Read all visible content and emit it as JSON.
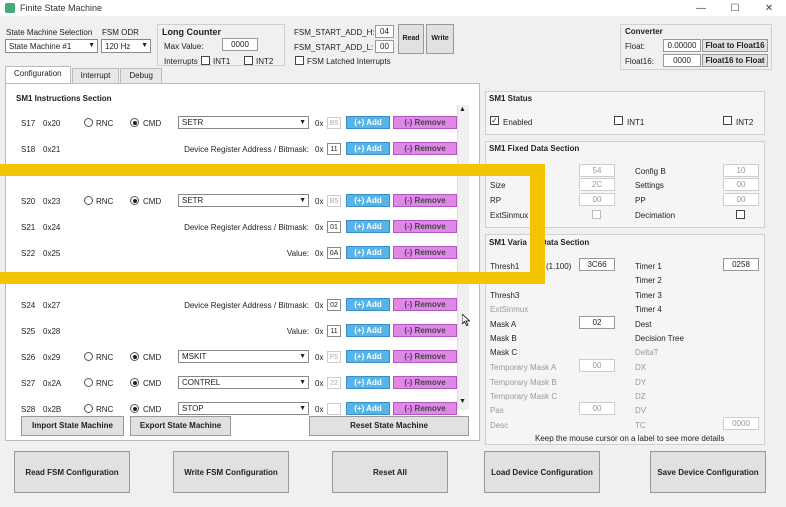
{
  "window": {
    "title": "Finite State Machine",
    "minimize": "—",
    "maximize": "☐",
    "close": "✕"
  },
  "top": {
    "state_machine_selection_label": "State Machine Selection",
    "state_machine_value": "State Machine #1",
    "fsm_odr_label": "FSM ODR",
    "fsm_odr_value": "120 Hz",
    "long_counter_title": "Long Counter",
    "max_value_label": "Max Value:",
    "max_value": "0000",
    "interrupts_label": "Interrupts",
    "int1_label": "INT1",
    "int2_label": "INT2",
    "fsm_start_add_h_label": "FSM_START_ADD_H:",
    "fsm_start_add_h_value": "04",
    "fsm_start_add_l_label": "FSM_START_ADD_L:",
    "fsm_start_add_l_value": "00",
    "read_label": "Read",
    "write_label": "Write",
    "fsm_latched_label": "FSM Latched Interrupts",
    "converter_title": "Converter",
    "float_label": "Float:",
    "float_value": "0.00000",
    "float_to_float16_label": "Float to Float16",
    "float16_label": "Float16:",
    "float16_value": "0000",
    "float16_to_float_label": "Float16 to Float"
  },
  "tabs": [
    "Configuration",
    "Interrupt",
    "Debug"
  ],
  "instructions": {
    "title": "SM1 Instructions Section",
    "rnc_label": "RNC",
    "cmd_label": "CMD",
    "add_label": "(+) Add",
    "remove_label": "(-) Remove",
    "ox_label": "0x",
    "rows": [
      {
        "id": "S17",
        "addr": "0x20",
        "type": "cmd",
        "cmd": "SETR",
        "hex": "B5"
      },
      {
        "id": "S18",
        "addr": "0x21",
        "type": "param",
        "param": "Device Register Address / Bitmask:",
        "hex": "11"
      },
      {
        "id": "",
        "addr": "",
        "type": "hidden"
      },
      {
        "id": "S20",
        "addr": "0x23",
        "type": "cmd",
        "cmd": "SETR",
        "hex": "B5"
      },
      {
        "id": "S21",
        "addr": "0x24",
        "type": "param",
        "param": "Device Register Address / Bitmask:",
        "hex": "01"
      },
      {
        "id": "S22",
        "addr": "0x25",
        "type": "param",
        "param": "Value:",
        "hex": "0A"
      },
      {
        "id": "",
        "addr": "",
        "type": "hidden"
      },
      {
        "id": "S24",
        "addr": "0x27",
        "type": "param",
        "param": "Device Register Address / Bitmask:",
        "hex": "02"
      },
      {
        "id": "S25",
        "addr": "0x28",
        "type": "param",
        "param": "Value:",
        "hex": "11"
      },
      {
        "id": "S26",
        "addr": "0x29",
        "type": "cmd",
        "cmd": "MSKIT",
        "hex": "F5"
      },
      {
        "id": "S27",
        "addr": "0x2A",
        "type": "cmd",
        "cmd": "CONTREL",
        "hex": "22"
      },
      {
        "id": "S28",
        "addr": "0x2B",
        "type": "cmd",
        "cmd": "STOP",
        "hex": ""
      }
    ]
  },
  "status": {
    "title": "SM1 Status",
    "enabled_label": "Enabled",
    "int1_label": "INT1",
    "int2_label": "INT2"
  },
  "fixed": {
    "title": "SM1 Fixed Data Section",
    "config_a_value": "54",
    "config_b_label": "Config B",
    "config_b_value": "10",
    "size_label": "Size",
    "size_value": "2C",
    "settings_label": "Settings",
    "settings_value": "00",
    "rp_label": "RP",
    "rp_value": "00",
    "pp_label": "PP",
    "pp_value": "00",
    "extsinmux_label": "ExtSinmux",
    "decimation_label": "Decimation"
  },
  "variable": {
    "title_start": "SM1 Varia",
    "title_end": "Data Section",
    "thresh1_label": "Thresh1",
    "thresh1_range": "(1.100)",
    "thresh1_value": "3C66",
    "timer1_label": "Timer 1",
    "timer1_value": "0258",
    "timer2_label": "Timer 2",
    "thresh3_label": "Thresh3",
    "timer3_label": "Timer 3",
    "extsinmux_label": "ExtSinmux",
    "timer4_label": "Timer 4",
    "mask_a_label": "Mask A",
    "mask_a_value": "02",
    "dest_label": "Dest",
    "mask_b_label": "Mask B",
    "decision_tree_label": "Decision Tree",
    "mask_c_label": "Mask C",
    "deltat_label": "DeltaT",
    "temp_mask_a_label": "Temporary Mask A",
    "temp_mask_a_value": "00",
    "dx_label": "DX",
    "temp_mask_b_label": "Temporary Mask B",
    "dy_label": "DY",
    "temp_mask_c_label": "Temporary Mask C",
    "dz_label": "DZ",
    "pas_label": "Pas",
    "pas_value": "00",
    "dv_label": "DV",
    "desc_label": "Desc",
    "tc_label": "TC",
    "tc_value": "0000",
    "hint": "Keep the mouse cursor on a label to see more details"
  },
  "actions": {
    "import": "Import State Machine",
    "export": "Export State Machine",
    "reset_sm": "Reset State Machine",
    "read_fsm": "Read FSM Configuration",
    "write_fsm": "Write FSM Configuration",
    "reset_all": "Reset All",
    "load_device": "Load Device Configuration",
    "save_device": "Save Device Configuration"
  },
  "colors": {
    "add": "#55b4e8",
    "remove": "#e088e8",
    "highlight": "#f5c400"
  }
}
